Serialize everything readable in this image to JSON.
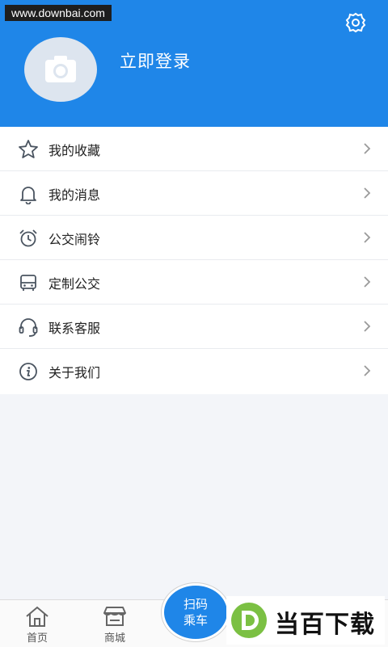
{
  "watermark": {
    "url": "www.downbai.com",
    "brand": "当百下载"
  },
  "header": {
    "login_label": "立即登录"
  },
  "icons": {
    "settings": "gear-icon",
    "avatar": "camera-icon",
    "favorites": "star-icon",
    "messages": "bell-icon",
    "alarm": "alarm-clock-icon",
    "custom_bus": "bus-icon",
    "service": "headset-icon",
    "about": "info-icon"
  },
  "menu": {
    "items": [
      {
        "label": "我的收藏"
      },
      {
        "label": "我的消息"
      },
      {
        "label": "公交闹铃"
      },
      {
        "label": "定制公交"
      },
      {
        "label": "联系客服"
      },
      {
        "label": "关于我们"
      }
    ]
  },
  "tabbar": {
    "home": "首页",
    "mall": "商城",
    "scan_line1": "扫码",
    "scan_line2": "乘车"
  },
  "colors": {
    "primary": "#1f86e8",
    "background": "#f3f5f9",
    "text": "#222222"
  }
}
